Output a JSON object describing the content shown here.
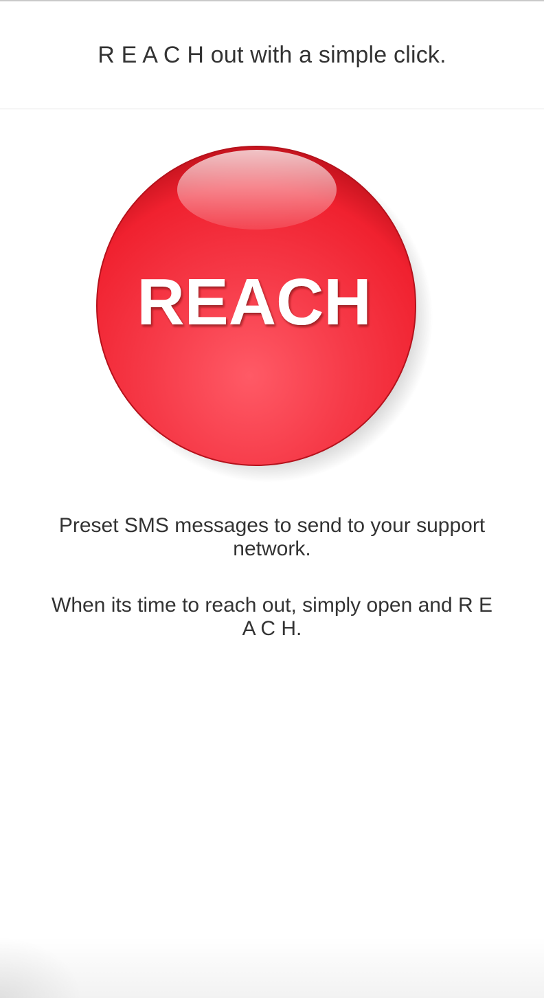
{
  "header": {
    "title": "R E A C H out with a simple click."
  },
  "reach_button": {
    "label": "REACH",
    "color": "#ec2035",
    "highlight_color": "#ff6b7a",
    "text_color": "#ffffff"
  },
  "content": {
    "message_1": "Preset SMS messages to send to your support network.",
    "message_2": "When its time to reach out, simply open and R E A C H."
  }
}
